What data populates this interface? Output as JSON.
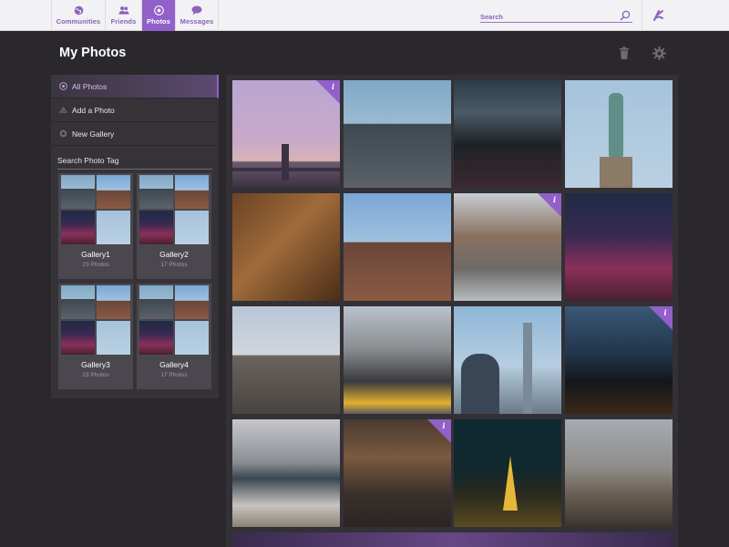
{
  "nav": {
    "items": [
      {
        "label": "Communities",
        "icon": "globe-icon"
      },
      {
        "label": "Friends",
        "icon": "friends-icon"
      },
      {
        "label": "Photos",
        "icon": "photos-icon",
        "active": true
      },
      {
        "label": "Messages",
        "icon": "chat-bubble-icon"
      }
    ],
    "search_placeholder": "Search",
    "search_icon": "search-icon",
    "brand_icon": "brand-logo-icon"
  },
  "header": {
    "title": "My Photos",
    "delete_icon": "trash-icon",
    "settings_icon": "gear-icon"
  },
  "sidebar": {
    "items": [
      {
        "label": "All Photos",
        "active": true
      },
      {
        "label": "Add a Photo"
      },
      {
        "label": "New Gallery"
      }
    ],
    "tag_search_placeholder": "Search Photo Tag",
    "galleries": [
      {
        "name": "Gallery1",
        "count": "23 Photos"
      },
      {
        "name": "Gallery2",
        "count": "17 Photos"
      },
      {
        "name": "Gallery3",
        "count": "23 Photos"
      },
      {
        "name": "Gallery4",
        "count": "17 Photos"
      }
    ]
  },
  "photos": [
    {
      "subject": "bridge-sunset",
      "info": true
    },
    {
      "subject": "flatiron",
      "info": false
    },
    {
      "subject": "times-square",
      "info": false
    },
    {
      "subject": "statue-of-liberty",
      "info": false
    },
    {
      "subject": "market",
      "info": false
    },
    {
      "subject": "manhattan-bridge",
      "info": false
    },
    {
      "subject": "street",
      "info": true
    },
    {
      "subject": "times-square-night",
      "info": false
    },
    {
      "subject": "brooklyn-bridge",
      "info": false
    },
    {
      "subject": "traffic",
      "info": false
    },
    {
      "subject": "observer",
      "info": false
    },
    {
      "subject": "night-city",
      "info": true
    },
    {
      "subject": "skyline-river",
      "info": false
    },
    {
      "subject": "cafe",
      "info": true
    },
    {
      "subject": "paris-night",
      "info": false
    },
    {
      "subject": "rooftop",
      "info": false
    }
  ],
  "colors": {
    "accent": "#9160c9",
    "nav_bg": "#f2f1f4",
    "page_bg": "#2a282c",
    "panel_bg": "#353238"
  }
}
